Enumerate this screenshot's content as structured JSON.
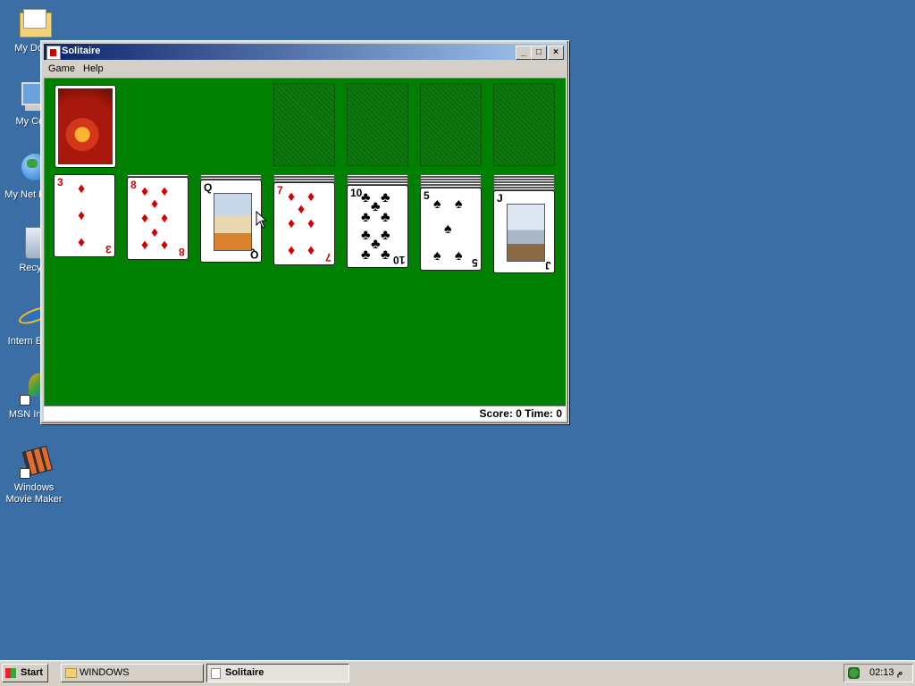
{
  "desktop": {
    "icons": [
      {
        "label": "My Docu",
        "icon": "my-documents-icon"
      },
      {
        "label": "My Com",
        "icon": "my-computer-icon"
      },
      {
        "label": "My Net Place",
        "icon": "network-places-icon"
      },
      {
        "label": "Recycl",
        "icon": "recycle-bin-icon"
      },
      {
        "label": "Intern Explo",
        "icon": "internet-explorer-icon"
      },
      {
        "label": "MSN Install",
        "icon": "msn-installer-icon"
      },
      {
        "label": "Windows Movie Maker",
        "icon": "movie-maker-icon"
      }
    ]
  },
  "window": {
    "title": "Solitaire",
    "buttons": {
      "minimize": "_",
      "maximize": "□",
      "close": "×"
    },
    "menu": [
      "Game",
      "Help"
    ],
    "status": "Score: 0 Time: 0"
  },
  "game": {
    "stock": {
      "back": "red-flower-card-back"
    },
    "foundations": 4,
    "tableau": [
      {
        "rank": "3",
        "suit": "♦",
        "color": "red"
      },
      {
        "rank": "8",
        "suit": "♦",
        "color": "red"
      },
      {
        "rank": "Q",
        "suit": "♣",
        "color": "black"
      },
      {
        "rank": "7",
        "suit": "♦",
        "color": "red"
      },
      {
        "rank": "10",
        "suit": "♣",
        "color": "black"
      },
      {
        "rank": "5",
        "suit": "♠",
        "color": "black"
      },
      {
        "rank": "J",
        "suit": "♠",
        "color": "black"
      }
    ]
  },
  "taskbar": {
    "start": "Start",
    "tasks": [
      {
        "label": "WINDOWS",
        "active": false
      },
      {
        "label": "Solitaire",
        "active": true
      }
    ],
    "clock": "02:13 م"
  },
  "colors": {
    "desktop": "#3a6ea5",
    "felt": "#008000",
    "title_start": "#0a246a",
    "title_end": "#a6caf0"
  }
}
